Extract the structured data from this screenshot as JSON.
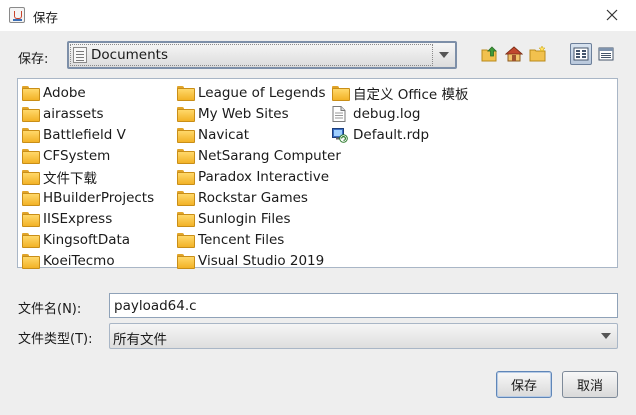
{
  "window": {
    "title": "保存"
  },
  "toolbar": {
    "lookin_label": "保存:",
    "lookin_value": "Documents",
    "buttons": [
      "up-one-level",
      "home",
      "new-folder",
      "list-view",
      "details-view"
    ]
  },
  "files": {
    "columns": [
      [
        {
          "name": "Adobe",
          "type": "folder"
        },
        {
          "name": "airassets",
          "type": "folder"
        },
        {
          "name": "Battlefield V",
          "type": "folder"
        },
        {
          "name": "CFSystem",
          "type": "folder"
        },
        {
          "name": "文件下载",
          "type": "folder"
        },
        {
          "name": "HBuilderProjects",
          "type": "folder"
        },
        {
          "name": "IISExpress",
          "type": "folder"
        },
        {
          "name": "KingsoftData",
          "type": "folder"
        },
        {
          "name": "KoeiTecmo",
          "type": "folder"
        }
      ],
      [
        {
          "name": "League of Legends",
          "type": "folder"
        },
        {
          "name": "My Web Sites",
          "type": "folder"
        },
        {
          "name": "Navicat",
          "type": "folder"
        },
        {
          "name": "NetSarang Computer",
          "type": "folder"
        },
        {
          "name": "Paradox Interactive",
          "type": "folder"
        },
        {
          "name": "Rockstar Games",
          "type": "folder"
        },
        {
          "name": "Sunlogin Files",
          "type": "folder"
        },
        {
          "name": "Tencent Files",
          "type": "folder"
        },
        {
          "name": "Visual Studio 2019",
          "type": "folder"
        }
      ],
      [
        {
          "name": "自定义 Office 模板",
          "type": "folder"
        },
        {
          "name": "debug.log",
          "type": "document"
        },
        {
          "name": "Default.rdp",
          "type": "rdp"
        }
      ]
    ]
  },
  "form": {
    "filename_label": "文件名(N):",
    "filename_value": "payload64.c",
    "filetype_label": "文件类型(T):",
    "filetype_value": "所有文件"
  },
  "buttons": {
    "save": "保存",
    "cancel": "取消"
  },
  "colors": {
    "client_bg": "#eeeeee",
    "folder": "#f2b227",
    "accent_border": "#7d8fa8"
  }
}
